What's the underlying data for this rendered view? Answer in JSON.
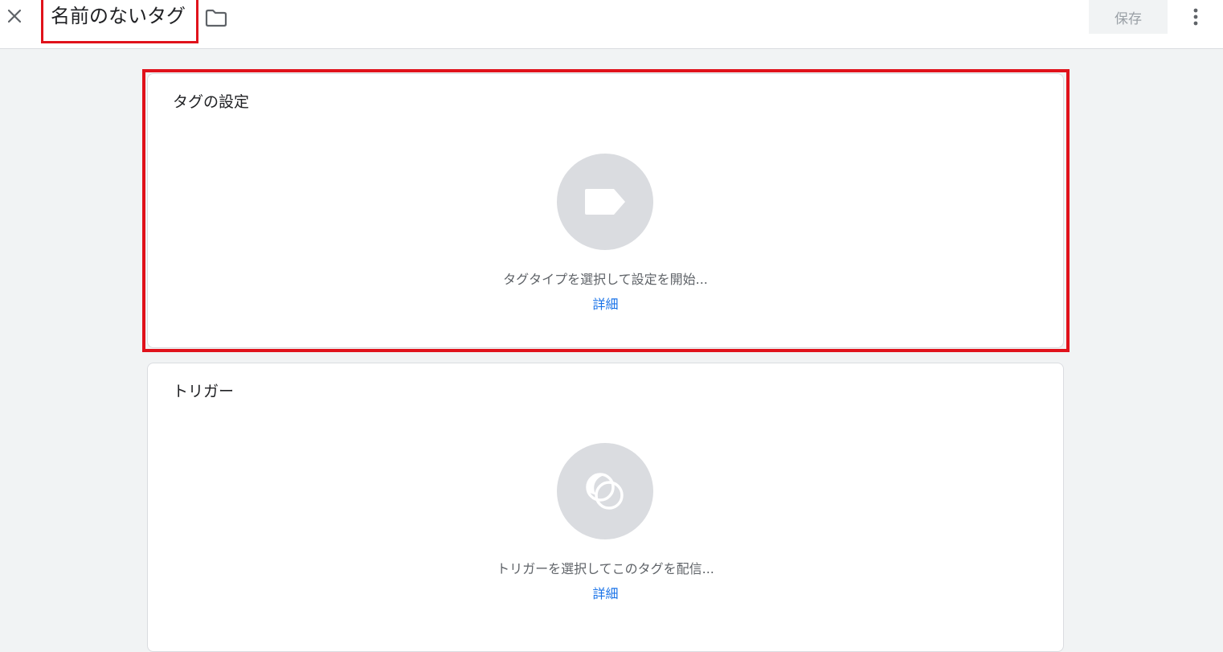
{
  "header": {
    "title": "名前のないタグ",
    "save_label": "保存",
    "close_icon": "close-icon",
    "folder_icon": "folder-icon",
    "more_icon": "more-vert-icon"
  },
  "tag_config": {
    "title": "タグの設定",
    "hint": "タグタイプを選択して設定を開始...",
    "link": "詳細",
    "icon": "tag-icon"
  },
  "trigger": {
    "title": "トリガー",
    "hint": "トリガーを選択してこのタグを配信...",
    "link": "詳細",
    "icon": "trigger-icon"
  },
  "colors": {
    "accent": "#1a73e8",
    "highlight": "#e0121b",
    "placeholder": "#dadce0"
  }
}
